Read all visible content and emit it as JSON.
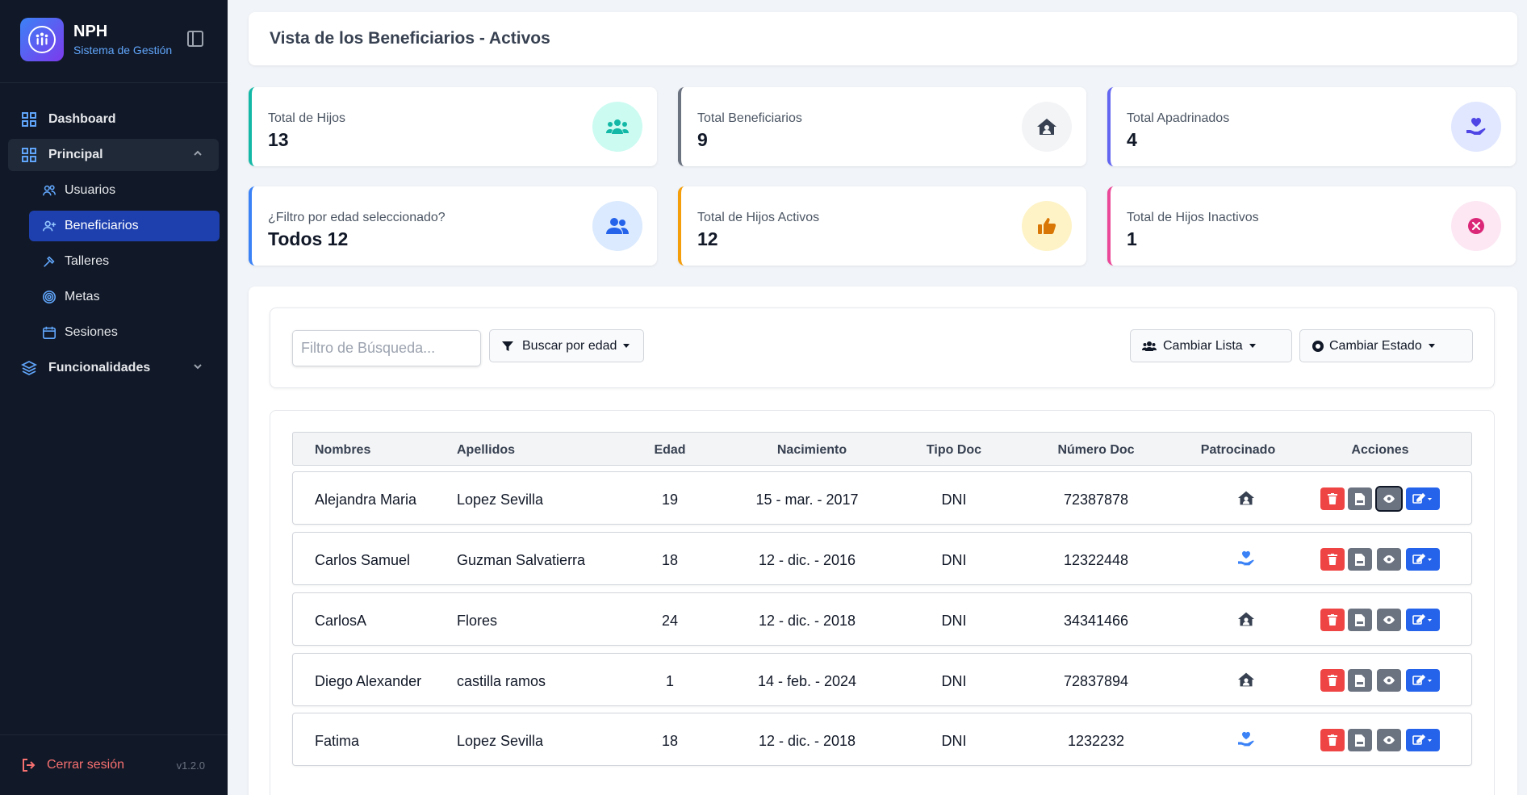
{
  "brand": {
    "title": "NPH",
    "subtitle": "Sistema de Gestión"
  },
  "sidebar": {
    "dashboard": "Dashboard",
    "principal": "Principal",
    "sub": [
      "Usuarios",
      "Beneficiarios",
      "Talleres",
      "Metas",
      "Sesiones"
    ],
    "funcionalidades": "Funcionalidades",
    "logout": "Cerrar sesión",
    "version": "v1.2.0"
  },
  "header": {
    "title": "Vista de los Beneficiarios - Activos"
  },
  "stats": [
    {
      "label": "Total de Hijos",
      "value": "13",
      "color": "#14b8a6",
      "icon": "users-icon"
    },
    {
      "label": "Total Beneficiarios",
      "value": "9",
      "color": "#6b7280",
      "icon": "home-icon"
    },
    {
      "label": "Total Apadrinados",
      "value": "4",
      "color": "#6366f1",
      "icon": "hand-heart-icon"
    },
    {
      "label": "¿Filtro por edad seleccionado?",
      "value": "Todos 12",
      "color": "#3b82f6",
      "icon": "user-group-icon"
    },
    {
      "label": "Total de Hijos Activos",
      "value": "12",
      "color": "#f59e0b",
      "icon": "thumbs-up-icon"
    },
    {
      "label": "Total de Hijos Inactivos",
      "value": "1",
      "color": "#ec4899",
      "icon": "x-circle-icon"
    }
  ],
  "filters": {
    "search_placeholder": "Filtro de Búsqueda...",
    "age_button": "Buscar por edad",
    "list_button": "Cambiar Lista",
    "state_button": "Cambiar Estado"
  },
  "table": {
    "headers": [
      "Nombres",
      "Apellidos",
      "Edad",
      "Nacimiento",
      "Tipo Doc",
      "Número Doc",
      "Patrocinado",
      "Acciones"
    ],
    "rows": [
      {
        "nombres": "Alejandra Maria",
        "apellidos": "Lopez Sevilla",
        "edad": "19",
        "nacimiento": "15 - mar. - 2017",
        "tipo": "DNI",
        "numero": "72387878",
        "patrocinado": "home"
      },
      {
        "nombres": "Carlos Samuel",
        "apellidos": "Guzman Salvatierra",
        "edad": "18",
        "nacimiento": "12 - dic. - 2016",
        "tipo": "DNI",
        "numero": "12322448",
        "patrocinado": "hand"
      },
      {
        "nombres": "CarlosA",
        "apellidos": "Flores",
        "edad": "24",
        "nacimiento": "12 - dic. - 2018",
        "tipo": "DNI",
        "numero": "34341466",
        "patrocinado": "home"
      },
      {
        "nombres": "Diego Alexander",
        "apellidos": "castilla ramos",
        "edad": "1",
        "nacimiento": "14 - feb. - 2024",
        "tipo": "DNI",
        "numero": "72837894",
        "patrocinado": "home"
      },
      {
        "nombres": "Fatima",
        "apellidos": "Lopez Sevilla",
        "edad": "18",
        "nacimiento": "12 - dic. - 2018",
        "tipo": "DNI",
        "numero": "1232232",
        "patrocinado": "hand"
      }
    ]
  }
}
